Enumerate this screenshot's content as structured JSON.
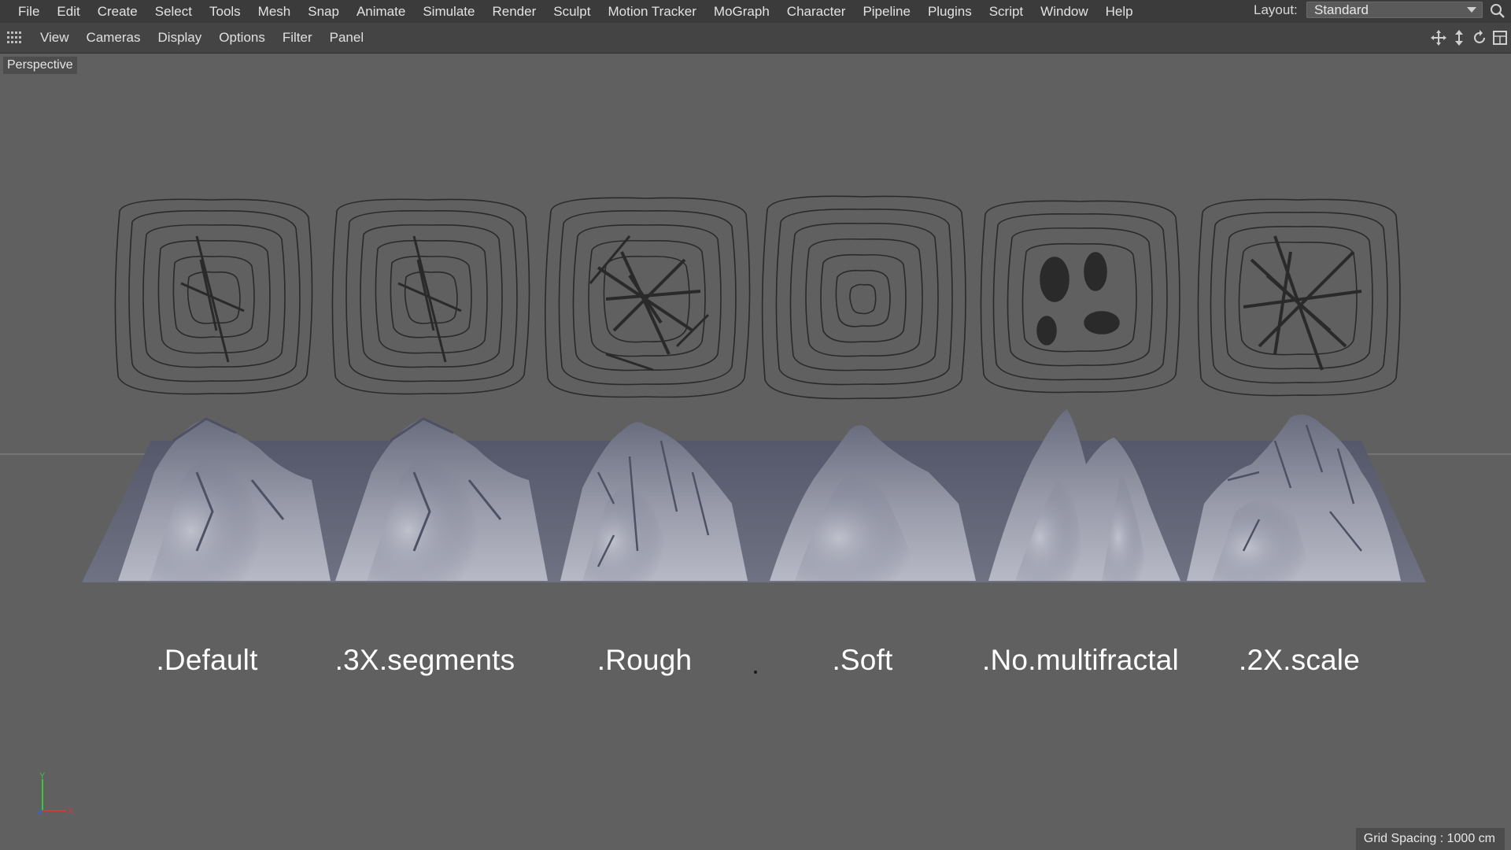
{
  "menubar": {
    "items": [
      "File",
      "Edit",
      "Create",
      "Select",
      "Tools",
      "Mesh",
      "Snap",
      "Animate",
      "Simulate",
      "Render",
      "Sculpt",
      "Motion Tracker",
      "MoGraph",
      "Character",
      "Pipeline",
      "Plugins",
      "Script",
      "Window",
      "Help"
    ],
    "layout_label": "Layout:",
    "layout_value": "Standard"
  },
  "viewbar": {
    "items": [
      "View",
      "Cameras",
      "Display",
      "Options",
      "Filter",
      "Panel"
    ]
  },
  "viewport": {
    "camera_label": "Perspective",
    "terrain_labels": [
      ".Default",
      ".3X.segments",
      ".Rough",
      ".Soft",
      ".No.multifractal",
      ".2X.scale"
    ],
    "grid_spacing": "Grid Spacing : 1000 cm",
    "axis_labels": {
      "y": "Y",
      "x": "X"
    }
  },
  "icons": {
    "grip": "grip-icon",
    "search": "search-icon",
    "nav_move": "move-view-icon",
    "nav_scale": "scale-view-icon",
    "nav_rotate": "rotate-view-icon",
    "nav_maximize": "maximize-view-icon"
  },
  "colors": {
    "menubar_bg": "#3b3b3b",
    "viewbar_bg": "#444444",
    "viewport_bg": "#606060",
    "axis_x": "#d23b3b",
    "axis_y": "#3ec43e",
    "axis_z": "#3a5fd6"
  }
}
